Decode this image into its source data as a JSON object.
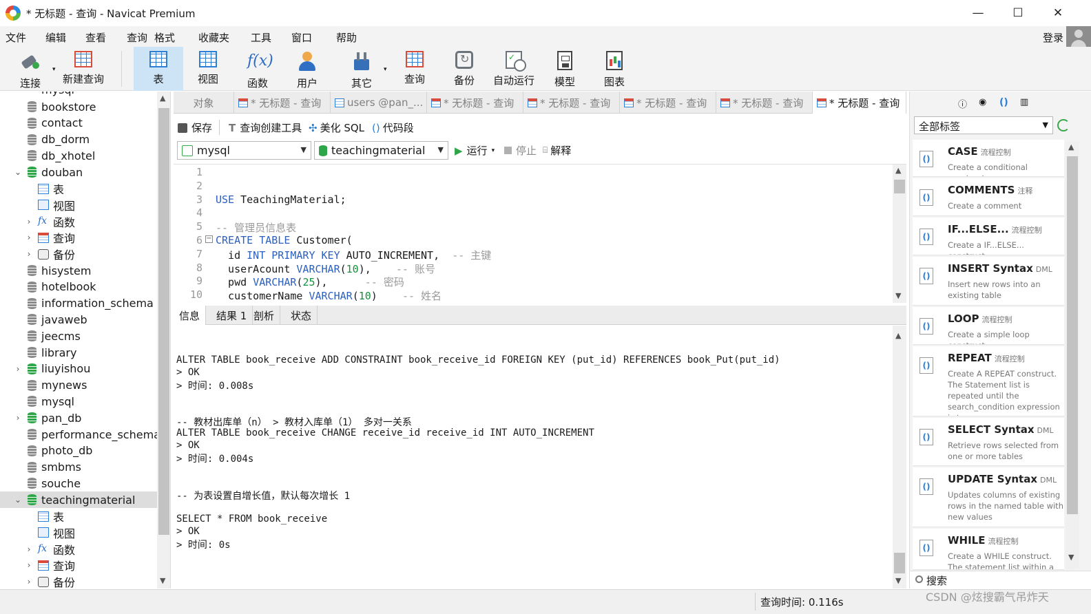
{
  "window": {
    "title": "* 无标题 - 查询 - Navicat Premium",
    "minimize": "—",
    "maximize": "☐",
    "close": "✕"
  },
  "menu": {
    "items": [
      "文件",
      "编辑",
      "查看",
      "查询",
      "格式",
      "收藏夹",
      "工具",
      "窗口",
      "帮助"
    ],
    "login": "登录"
  },
  "toolbar": {
    "buttons": [
      "连接",
      "新建查询",
      "表",
      "视图",
      "函数",
      "用户",
      "其它",
      "查询",
      "备份",
      "自动运行",
      "模型",
      "图表"
    ],
    "active": "表"
  },
  "tree": {
    "partial_top": "mysql",
    "rows": [
      {
        "label": "bookstore",
        "type": "db"
      },
      {
        "label": "contact",
        "type": "db"
      },
      {
        "label": "db_dorm",
        "type": "db"
      },
      {
        "label": "db_xhotel",
        "type": "db"
      },
      {
        "label": "douban",
        "type": "db-open"
      },
      {
        "label": "表",
        "type": "tables"
      },
      {
        "label": "视图",
        "type": "views"
      },
      {
        "label": "函数",
        "type": "functions"
      },
      {
        "label": "查询",
        "type": "queries"
      },
      {
        "label": "备份",
        "type": "backups"
      },
      {
        "label": "hisystem",
        "type": "db"
      },
      {
        "label": "hotelbook",
        "type": "db"
      },
      {
        "label": "information_schema",
        "type": "db"
      },
      {
        "label": "javaweb",
        "type": "db"
      },
      {
        "label": "jeecms",
        "type": "db"
      },
      {
        "label": "library",
        "type": "db"
      },
      {
        "label": "liuyishou",
        "type": "db-green"
      },
      {
        "label": "mynews",
        "type": "db"
      },
      {
        "label": "mysql",
        "type": "db"
      },
      {
        "label": "pan_db",
        "type": "db-green"
      },
      {
        "label": "performance_schema",
        "type": "db"
      },
      {
        "label": "photo_db",
        "type": "db"
      },
      {
        "label": "smbms",
        "type": "db"
      },
      {
        "label": "souche",
        "type": "db"
      },
      {
        "label": "teachingmaterial",
        "type": "db-open-selected"
      },
      {
        "label": "表",
        "type": "tables"
      },
      {
        "label": "视图",
        "type": "views"
      },
      {
        "label": "函数",
        "type": "functions"
      },
      {
        "label": "查询",
        "type": "queries"
      },
      {
        "label": "备份",
        "type": "backups"
      }
    ]
  },
  "tabs": [
    {
      "label": "对象",
      "active": false
    },
    {
      "label": "* 无标题 - 查询",
      "active": false
    },
    {
      "label": "users @pan_...",
      "active": false
    },
    {
      "label": "* 无标题 - 查询",
      "active": false
    },
    {
      "label": "* 无标题 - 查询",
      "active": false
    },
    {
      "label": "* 无标题 - 查询",
      "active": false
    },
    {
      "label": "* 无标题 - 查询",
      "active": false
    },
    {
      "label": "* 无标题 - 查询",
      "active": true
    }
  ],
  "query_toolbar": {
    "save": "保存",
    "builder": "查询创建工具",
    "beautify": "美化 SQL",
    "snippet": "代码段",
    "connection": "mysql",
    "database": "teachingmaterial",
    "run": "运行",
    "stop": "停止",
    "explain": "解释"
  },
  "editor": {
    "lines": [
      {
        "n": "1",
        "segs": []
      },
      {
        "n": "2",
        "segs": []
      },
      {
        "n": "3",
        "segs": [
          {
            "t": "USE",
            "c": "kw"
          },
          {
            "t": " TeachingMaterial;",
            "c": ""
          }
        ]
      },
      {
        "n": "4",
        "segs": []
      },
      {
        "n": "5",
        "segs": [
          {
            "t": "-- 管理员信息表",
            "c": "cm"
          }
        ]
      },
      {
        "n": "6",
        "segs": [
          {
            "t": "CREATE TABLE",
            "c": "kw"
          },
          {
            "t": " Customer(",
            "c": ""
          }
        ]
      },
      {
        "n": "7",
        "segs": [
          {
            "t": "  id ",
            "c": ""
          },
          {
            "t": "INT PRIMARY KEY",
            "c": "kw"
          },
          {
            "t": " AUTO_INCREMENT,  ",
            "c": ""
          },
          {
            "t": "-- 主键",
            "c": "cm"
          }
        ]
      },
      {
        "n": "8",
        "segs": [
          {
            "t": "  userAcount ",
            "c": ""
          },
          {
            "t": "VARCHAR",
            "c": "kw"
          },
          {
            "t": "(",
            "c": ""
          },
          {
            "t": "10",
            "c": "num"
          },
          {
            "t": "),    ",
            "c": ""
          },
          {
            "t": "-- 账号",
            "c": "cm"
          }
        ]
      },
      {
        "n": "9",
        "segs": [
          {
            "t": "  pwd ",
            "c": ""
          },
          {
            "t": "VARCHAR",
            "c": "kw"
          },
          {
            "t": "(",
            "c": ""
          },
          {
            "t": "25",
            "c": "num"
          },
          {
            "t": "),      ",
            "c": ""
          },
          {
            "t": "-- 密码",
            "c": "cm"
          }
        ]
      },
      {
        "n": "10",
        "segs": [
          {
            "t": "  customerName ",
            "c": ""
          },
          {
            "t": "VARCHAR",
            "c": "kw"
          },
          {
            "t": "(",
            "c": ""
          },
          {
            "t": "10",
            "c": "num"
          },
          {
            "t": ")    ",
            "c": ""
          },
          {
            "t": "-- 姓名",
            "c": "cm"
          }
        ]
      }
    ]
  },
  "result_tabs": [
    {
      "label": "信息",
      "active": true
    },
    {
      "label": "结果 1",
      "active": false
    },
    {
      "label": "剖析",
      "active": false
    },
    {
      "label": "状态",
      "active": false
    }
  ],
  "messages": [
    "ALTER TABLE book_receive ADD CONSTRAINT book_receive_id FOREIGN KEY (put_id) REFERENCES book_Put(put_id)",
    "> OK",
    "> 时间: 0.008s",
    "",
    "",
    "-- 教材出库单（n） > 教材入库单（1） 多对一关系",
    "ALTER TABLE book_receive CHANGE receive_id receive_id INT AUTO_INCREMENT",
    "> OK",
    "> 时间: 0.004s",
    "",
    "",
    "-- 为表设置自增长值，默认每次增长 1",
    "",
    "SELECT * FROM book_receive",
    "> OK",
    "> 时间: 0s"
  ],
  "status": {
    "query_time": "查询时间: 0.116s"
  },
  "watermark": "CSDN @炫搜霸气吊炸天",
  "snippets": {
    "filter": "全部标签",
    "items": [
      {
        "title": "CASE",
        "tag": "流程控制",
        "desc": "Create a conditional construct"
      },
      {
        "title": "COMMENTS",
        "tag": "注释",
        "desc": "Create a comment"
      },
      {
        "title": "IF...ELSE...",
        "tag": "流程控制",
        "desc": "Create a IF...ELSE... construct"
      },
      {
        "title": "INSERT Syntax",
        "tag": "DML",
        "desc": "Insert new rows into an existing table"
      },
      {
        "title": "LOOP",
        "tag": "流程控制",
        "desc": "Create a simple loop construct"
      },
      {
        "title": "REPEAT",
        "tag": "流程控制",
        "desc": "Create A REPEAT construct. The Statement list is repeated until the search_condition expression is true."
      },
      {
        "title": "SELECT Syntax",
        "tag": "DML",
        "desc": "Retrieve rows selected from one or more tables"
      },
      {
        "title": "UPDATE Syntax",
        "tag": "DML",
        "desc": "Updates columns of existing rows in the named table with new values"
      },
      {
        "title": "WHILE",
        "tag": "流程控制",
        "desc": "Create a WHILE construct. The statement list within a WHILE"
      }
    ],
    "search": "搜索"
  }
}
